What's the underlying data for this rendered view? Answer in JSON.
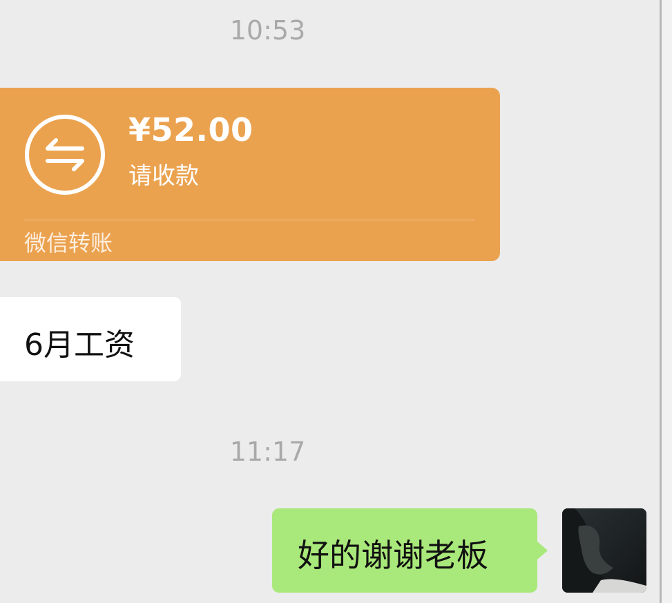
{
  "chat": {
    "timestamps": [
      "10:53",
      "11:17"
    ],
    "transfer": {
      "amount": "¥52.00",
      "status": "请收款",
      "footer": "微信转账",
      "icon": "transfer-arrows-icon",
      "color": "#eba24f"
    },
    "messages": [
      {
        "side": "left",
        "text": "6月工资"
      },
      {
        "side": "right",
        "text": "好的谢谢老板"
      }
    ],
    "colors": {
      "background": "#ececec",
      "bubble_self": "#a9e87a",
      "bubble_other": "#ffffff",
      "timestamp": "#a9a9a9"
    }
  }
}
